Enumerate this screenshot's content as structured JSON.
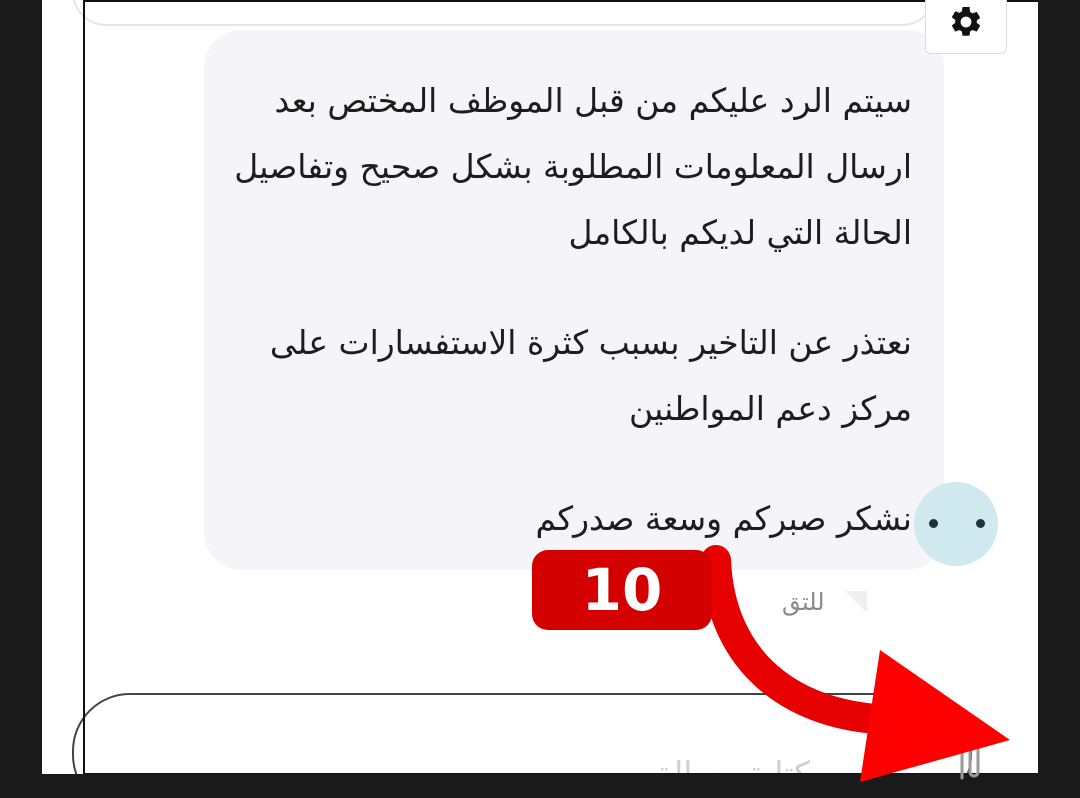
{
  "chat": {
    "message_lines": [
      "سيتم الرد عليكم من قبل الموظف المختص بعد",
      "ارسال المعلومات المطلوبة بشكل صحيح وتفاصيل",
      "الحالة التي لديكم بالكامل",
      "نعتذر عن التاخير بسبب كثرة الاستفسارات على",
      "مركز دعم المواطنين",
      "نشكر صبركم وسعة صدركم"
    ],
    "message_meta": "للتق"
  },
  "composer": {
    "placeholder": "كتابة رسالة"
  },
  "annotation": {
    "step_number": "10",
    "color": "#d40000"
  },
  "icons": {
    "settings": "gear-icon",
    "attach": "paperclip-icon",
    "avatar": "bot-avatar"
  }
}
